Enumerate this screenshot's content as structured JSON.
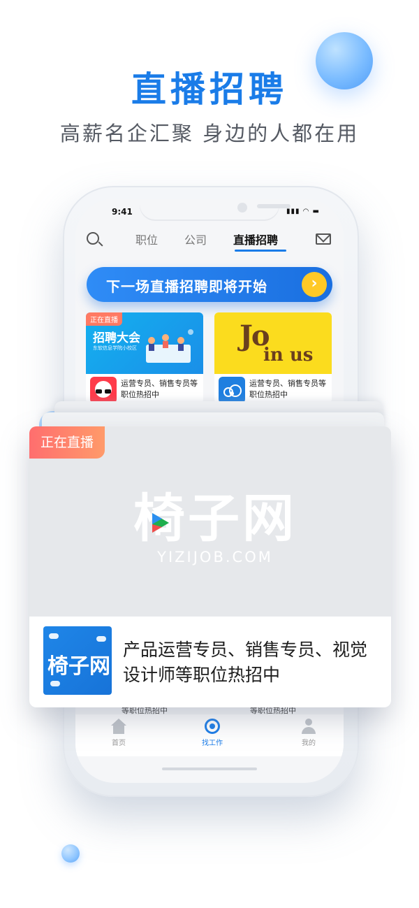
{
  "header": {
    "title": "直播招聘",
    "subtitle": "高薪名企汇聚  身边的人都在用"
  },
  "phone": {
    "status_time": "9:41",
    "status_icons": "▮▮▮ ◠ ▬",
    "nav": {
      "tabs": [
        {
          "label": "职位",
          "active": false
        },
        {
          "label": "公司",
          "active": false
        },
        {
          "label": "直播招聘",
          "active": true
        }
      ]
    },
    "banner": {
      "text": "下一场直播招聘即将开始",
      "arrow": "›"
    },
    "cards": [
      {
        "live_tag": "正在直播",
        "title": "招聘大会",
        "subtitle": "东软信息学院小校区",
        "desc": "运营专员、销售专员等职位热招中"
      },
      {
        "art_text_1": "Jo",
        "art_text_2": "in us",
        "desc": "运营专员、销售专员等职位热招中"
      }
    ],
    "bottom_fragments": [
      "等职位热招中",
      "等职位热招中"
    ],
    "tabbar": [
      {
        "label": "首页",
        "active": false
      },
      {
        "label": "找工作",
        "active": true
      },
      {
        "label": "我的",
        "active": false
      }
    ]
  },
  "featured": {
    "live_tag": "正在直播",
    "watermark_cn": "椅子网",
    "watermark_en": "YIZIJOB.COM",
    "logo_text": "椅子网",
    "description": "产品运营专员、销售专员、视觉设计师等职位热招中"
  },
  "colors": {
    "primary": "#1a7ce8",
    "live_tag": "#ff7a63",
    "banner_arrow": "#ffc926"
  },
  "icons": [
    "search-icon",
    "mail-icon",
    "chevron-right-icon",
    "home-icon",
    "target-icon",
    "user-icon",
    "play-icon"
  ]
}
